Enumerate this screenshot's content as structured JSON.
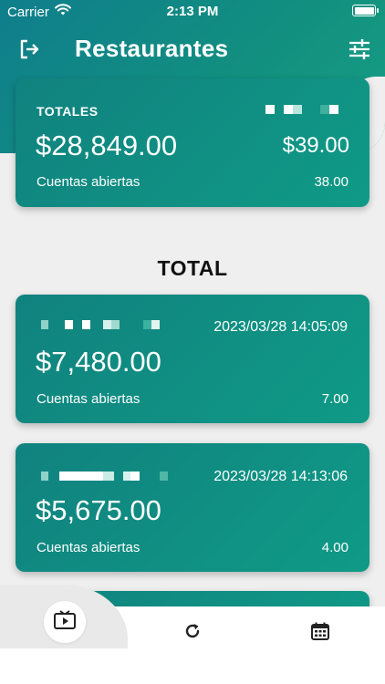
{
  "status_bar": {
    "carrier": "Carrier",
    "time": "2:13 PM",
    "wifi_icon": "wifi-icon",
    "battery_icon": "battery-icon"
  },
  "nav": {
    "title": "Restaurantes",
    "exit_icon": "logout-icon",
    "filter_icon": "sliders-icon"
  },
  "totals_card": {
    "label": "TOTALES",
    "amount": "$28,849.00",
    "secondary_amount": "$39.00",
    "accounts_label": "Cuentas abiertas",
    "accounts_value": "38.00"
  },
  "section": {
    "title": "TOTAL"
  },
  "entries": [
    {
      "datetime": "2023/03/28 14:05:09",
      "amount": "$7,480.00",
      "accounts_label": "Cuentas abiertas",
      "accounts_value": "7.00"
    },
    {
      "datetime": "2023/03/28 14:13:06",
      "amount": "$5,675.00",
      "accounts_label": "Cuentas abiertas",
      "accounts_value": "4.00"
    }
  ],
  "tab_bar": {
    "tabs": [
      {
        "icon": "tv-play-icon",
        "active": true
      },
      {
        "icon": "refresh-icon",
        "active": false
      },
      {
        "icon": "calendar-icon",
        "active": false
      }
    ]
  },
  "colors": {
    "primary": "#0f8c84",
    "background": "#efefef",
    "text_dark": "#111111"
  }
}
